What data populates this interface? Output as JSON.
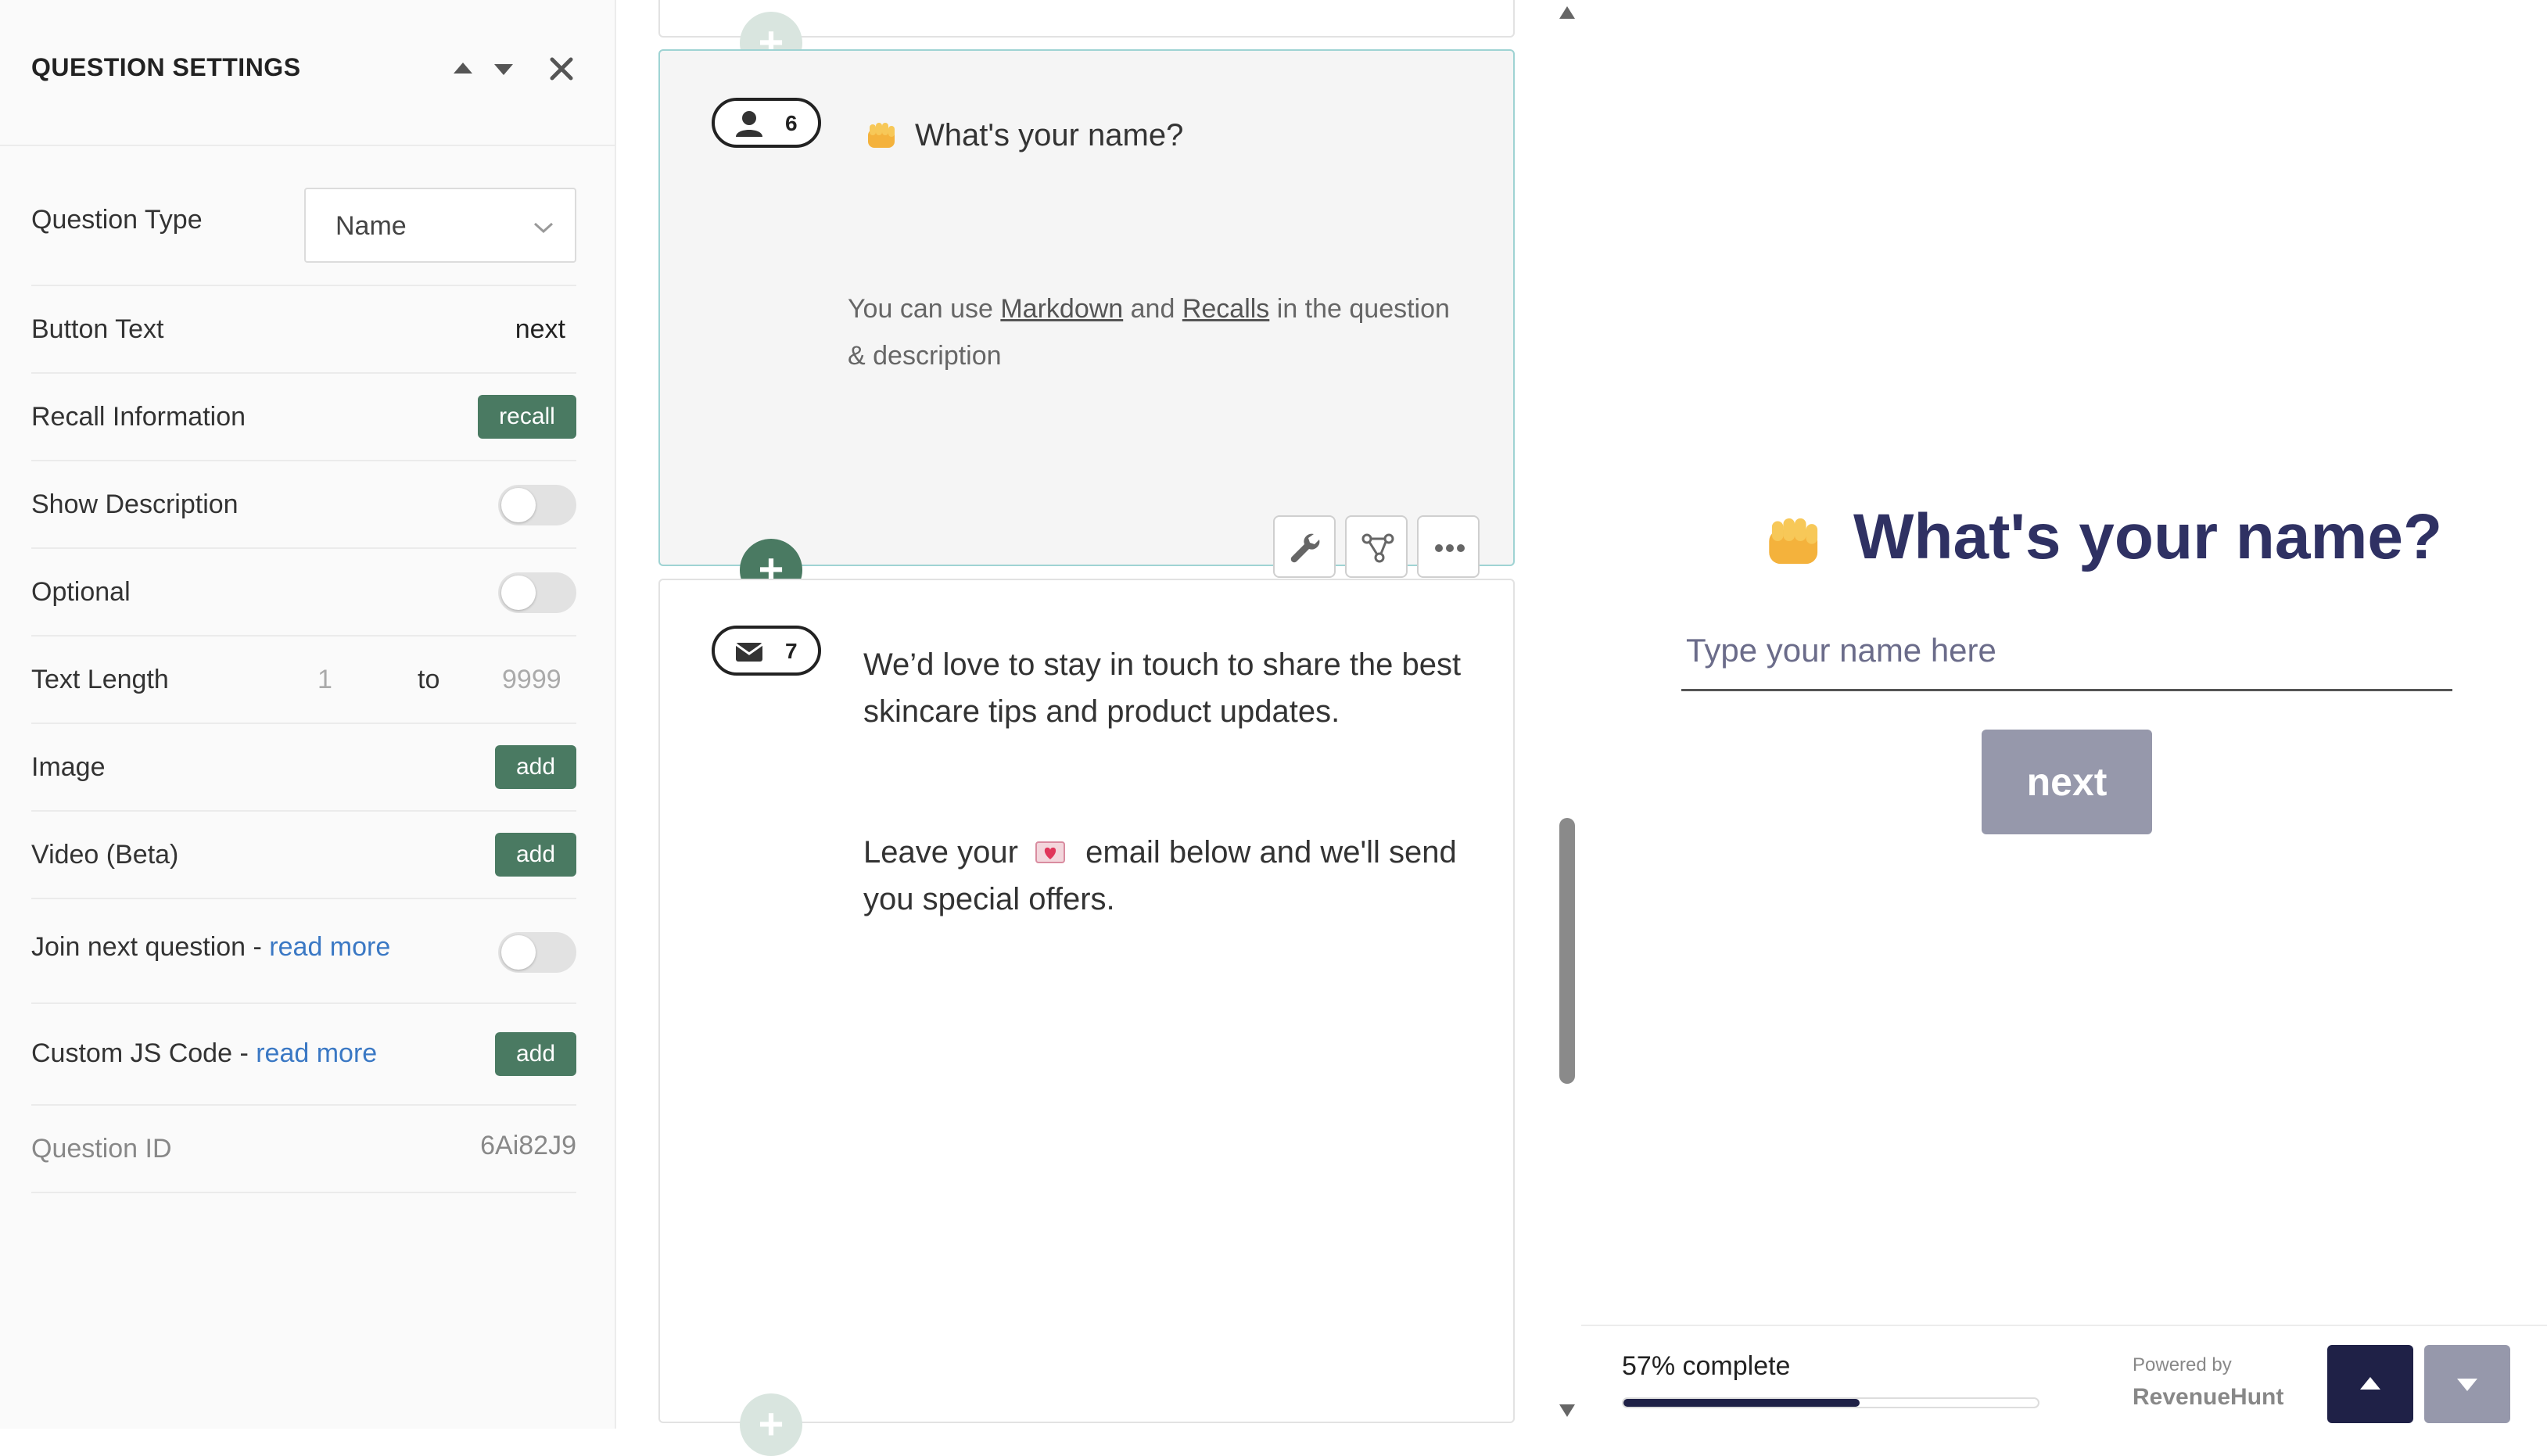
{
  "settings": {
    "title": "QUESTION SETTINGS",
    "rows": {
      "question_type": {
        "label": "Question Type",
        "value": "Name"
      },
      "button_text": {
        "label": "Button Text",
        "value": "next"
      },
      "recall_information": {
        "label": "Recall Information",
        "button": "recall"
      },
      "show_description": {
        "label": "Show Description",
        "enabled": false
      },
      "optional": {
        "label": "Optional",
        "enabled": false
      },
      "text_length": {
        "label": "Text Length",
        "min": "1",
        "separator": "to",
        "max": "9999"
      },
      "image": {
        "label": "Image",
        "button": "add"
      },
      "video": {
        "label": "Video (Beta)",
        "button": "add"
      },
      "join_next": {
        "label": "Join next question - ",
        "link": "read more",
        "enabled": false
      },
      "custom_js": {
        "label": "Custom JS Code - ",
        "link": "read more",
        "button": "add"
      },
      "question_id": {
        "label": "Question ID",
        "value": "6Ai82J9"
      }
    }
  },
  "builder": {
    "questions": [
      {
        "number": "6",
        "icon": "user-icon",
        "title": "What's your name?",
        "hint": {
          "before": "You can use ",
          "link1": "Markdown",
          "middle": " and ",
          "link2": "Recalls",
          "after1": " in the question",
          "after2": "& description"
        }
      },
      {
        "number": "7",
        "icon": "envelope-icon",
        "text1": "We’d love to stay in touch to share the best",
        "text2": "skincare tips and product updates.",
        "text3a": "Leave your",
        "text3b": "email below and we'll send",
        "text4": "you special offers."
      }
    ],
    "add_symbol": "+"
  },
  "preview": {
    "title": "What's your name?",
    "input_placeholder": "Type your name here",
    "next_label": "next",
    "progress_text": "57% complete",
    "progress": 0.57,
    "powered_by": "Powered by",
    "brand": "RevenueHunt"
  },
  "colors": {
    "accent_green": "#4a7a62",
    "preview_title": "#2f3163",
    "nav_dark": "#1f2147",
    "next_button": "#9698ab",
    "active_card_border": "#9fd3d3"
  }
}
